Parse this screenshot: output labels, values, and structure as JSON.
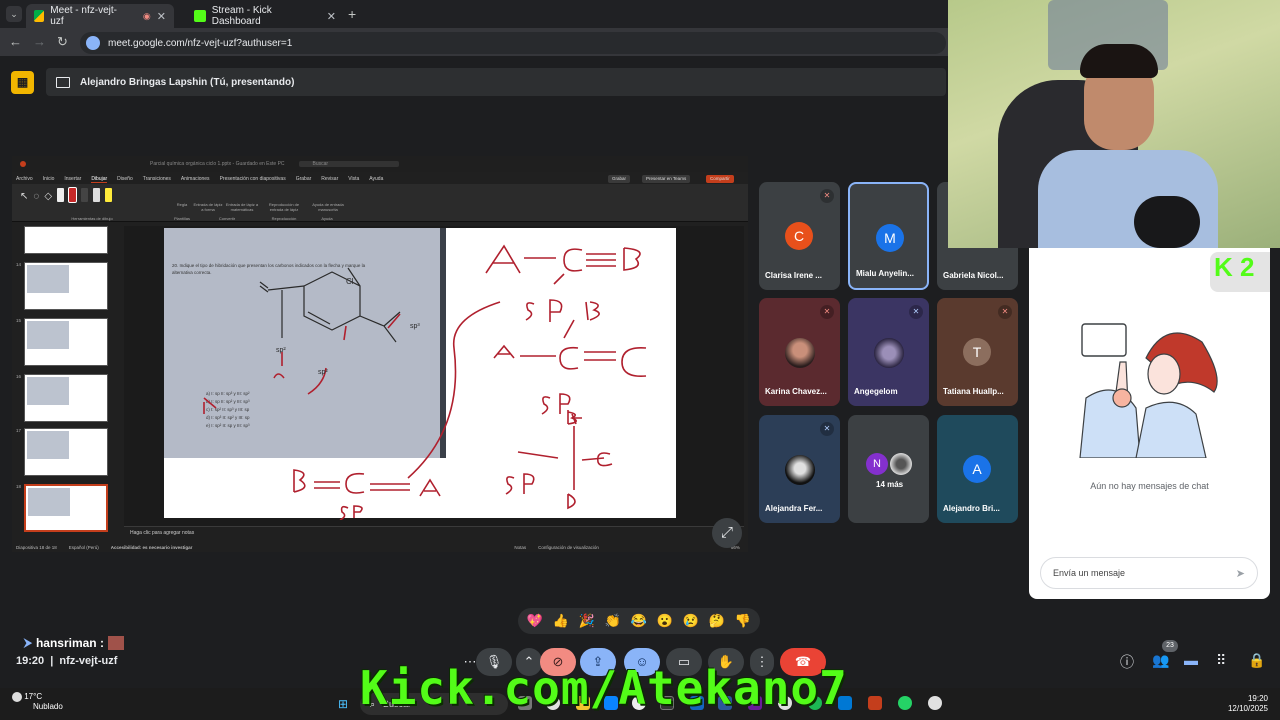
{
  "browser": {
    "tabs": [
      {
        "label": "Meet - nfz-vejt-uzf",
        "active": true
      },
      {
        "label": "Stream - Kick Dashboard",
        "active": false
      }
    ],
    "url": "meet.google.com/nfz-vejt-uzf?authuser=1"
  },
  "meet": {
    "presenter_label": "Alejandro Bringas Lapshin (Tú, presentando)",
    "meeting_code": "nfz-vejt-uzf",
    "time": "19:20",
    "people_count": "23",
    "participants": [
      {
        "name": "Clarisa Irene ...",
        "initial": "C",
        "color": "#e8501b",
        "muted": true
      },
      {
        "name": "Mialu Anyelin...",
        "initial": "M",
        "color": "#1a73e8",
        "muted": false,
        "selected": true
      },
      {
        "name": "Gabriela Nicol...",
        "initial": "",
        "color": "",
        "muted": false
      },
      {
        "name": "Karina Chavez...",
        "initial": "",
        "color": "",
        "muted": true
      },
      {
        "name": "Angegelom",
        "initial": "",
        "color": "",
        "muted": true
      },
      {
        "name": "Tatiana Huallp...",
        "initial": "T",
        "color": "#8c6e5e",
        "muted": true
      },
      {
        "name": "Alejandra Fer...",
        "initial": "",
        "color": "",
        "muted": true
      },
      {
        "name": "14 más",
        "initial": "N",
        "color": "#8430ce",
        "muted": false
      },
      {
        "name": "Alejandro Bri...",
        "initial": "A",
        "color": "#1a73e8",
        "muted": false
      }
    ],
    "chat_empty": "Aún no hay mensajes de chat",
    "chat_placeholder": "Envía un mensaje",
    "reactions": [
      "💖",
      "👍",
      "🎉",
      "👏",
      "😂",
      "😮",
      "😢",
      "🤔",
      "👎"
    ]
  },
  "ppt": {
    "title": "Parcial química orgánica ciclo 1.pptx - Guardado en Este PC",
    "search": "Buscar",
    "menu": [
      "Archivo",
      "Inicio",
      "Insertar",
      "Dibujar",
      "Diseño",
      "Transiciones",
      "Animaciones",
      "Presentación con diapositivas",
      "Grabar",
      "Revisar",
      "Vista",
      "Ayuda"
    ],
    "buttons": {
      "record": "Grabar",
      "teams": "Presentar en Teams",
      "share": "Compartir"
    },
    "ribbon_groups": [
      "Herramientas de dibujo",
      "Plantillas",
      "Convertir",
      "Reproducción",
      "Ayuda"
    ],
    "ribbon_items": [
      "Regla",
      "Entrada de lápiz a forma",
      "Entrada de lápiz a matemáticas",
      "Reproducción de entrada de lápiz",
      "Ayuda de entrada manuscrita"
    ],
    "thumb_numbers": [
      "14",
      "15",
      "16",
      "17",
      "18"
    ],
    "scan_lines": [
      "20. Indique el tipo de hibridación que presentan los carbonos indicados con la flecha y marque la",
      "alternativa correcta."
    ],
    "options": [
      "a) I: sp     II: sp³   y   III: sp²",
      "b) I: sp     II: sp²   y   III: sp³",
      "c) I: sp²   II: sp³   y   III: sp",
      "d) I: sp³   II: sp²   y   III: sp",
      "e) I: sp²   II: sp    y   III: sp³"
    ],
    "notes_placeholder": "Haga clic para agregar notas",
    "status": {
      "slide": "Diapositiva 18 de 18",
      "lang": "Español (Perú)",
      "access": "Accesibilidad: es necesario investigar",
      "notes": "Notas",
      "view": "Configuración de visualización",
      "zoom": "66%"
    }
  },
  "stream": {
    "chat_user": "hansriman :",
    "kick_url": "Kick.com/Atekano7",
    "kick_badge": "K 2"
  },
  "taskbar": {
    "temp": "17°C",
    "weather": "Nublado",
    "search": "Buscar",
    "time": "19:20",
    "date": "12/10/2025"
  }
}
